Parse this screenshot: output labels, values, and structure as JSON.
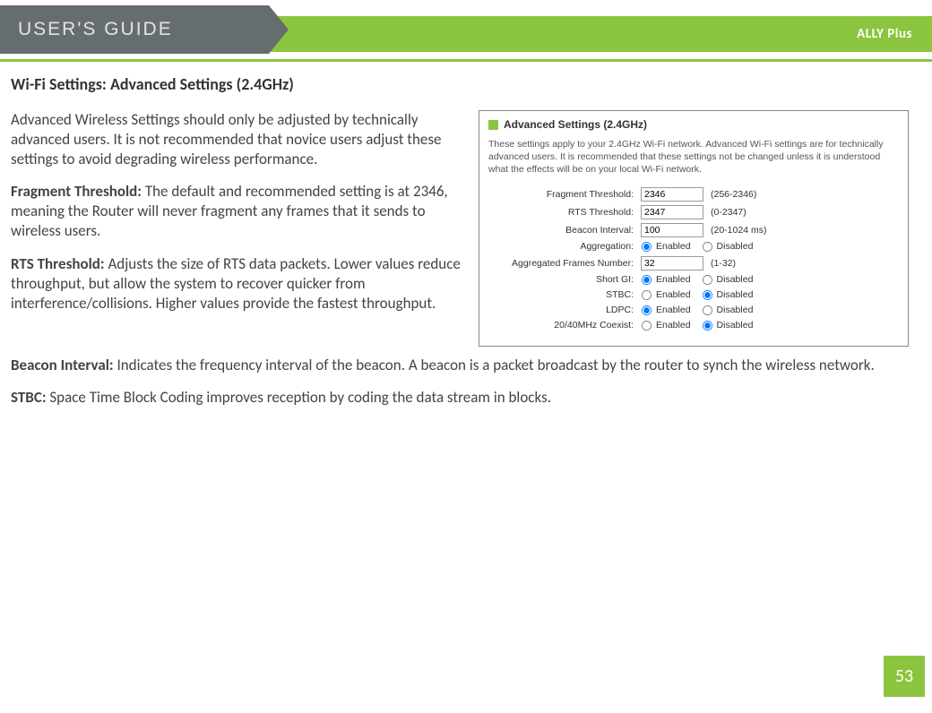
{
  "header": {
    "guide_label": "USER'S GUIDE",
    "product": "ALLY Plus"
  },
  "page": {
    "title": "Wi-Fi Settings: Advanced Settings (2.4GHz)",
    "number": "53"
  },
  "paragraphs": {
    "intro": "Advanced Wireless Settings should only be adjusted by technically advanced users. It is not recommended that novice users adjust these settings to avoid degrading wireless performance.",
    "fragment_label": "Fragment Threshold: ",
    "fragment_text": "The default and recommended setting is at 2346, meaning the Router will never fragment any frames that it sends to wireless users.",
    "rts_label": "RTS Threshold: ",
    "rts_text": "Adjusts the size of RTS data packets. Lower values reduce throughput, but allow the system to recover quicker from interference/collisions. Higher values provide the fastest throughput.",
    "beacon_label": "Beacon Interval: ",
    "beacon_text": "Indicates the frequency interval of the beacon. A beacon is a packet broadcast by the router to synch the wireless network.",
    "stbc_label": "STBC: ",
    "stbc_text": "Space Time Block Coding improves reception by coding the data stream in blocks."
  },
  "panel": {
    "title": "Advanced Settings (2.4GHz)",
    "desc": "These settings apply to your 2.4GHz Wi-Fi network. Advanced Wi-Fi settings are for technically advanced users. It is recommended that these settings not be changed unless it is understood what the effects will be on your local Wi-Fi network.",
    "labels": {
      "fragment": "Fragment Threshold:",
      "rts": "RTS Threshold:",
      "beacon": "Beacon Interval:",
      "aggregation": "Aggregation:",
      "agg_frames": "Aggregated Frames Number:",
      "short_gi": "Short GI:",
      "stbc": "STBC:",
      "ldpc": "LDPC:",
      "coexist": "20/40MHz Coexist:"
    },
    "values": {
      "fragment": "2346",
      "rts": "2347",
      "beacon": "100",
      "agg_frames": "32"
    },
    "ranges": {
      "fragment": "(256-2346)",
      "rts": "(0-2347)",
      "beacon": "(20-1024 ms)",
      "agg_frames": "(1-32)"
    },
    "radio": {
      "enabled": "Enabled",
      "disabled": "Disabled"
    },
    "selections": {
      "aggregation": "enabled",
      "short_gi": "enabled",
      "stbc": "disabled",
      "ldpc": "enabled",
      "coexist": "disabled"
    }
  }
}
